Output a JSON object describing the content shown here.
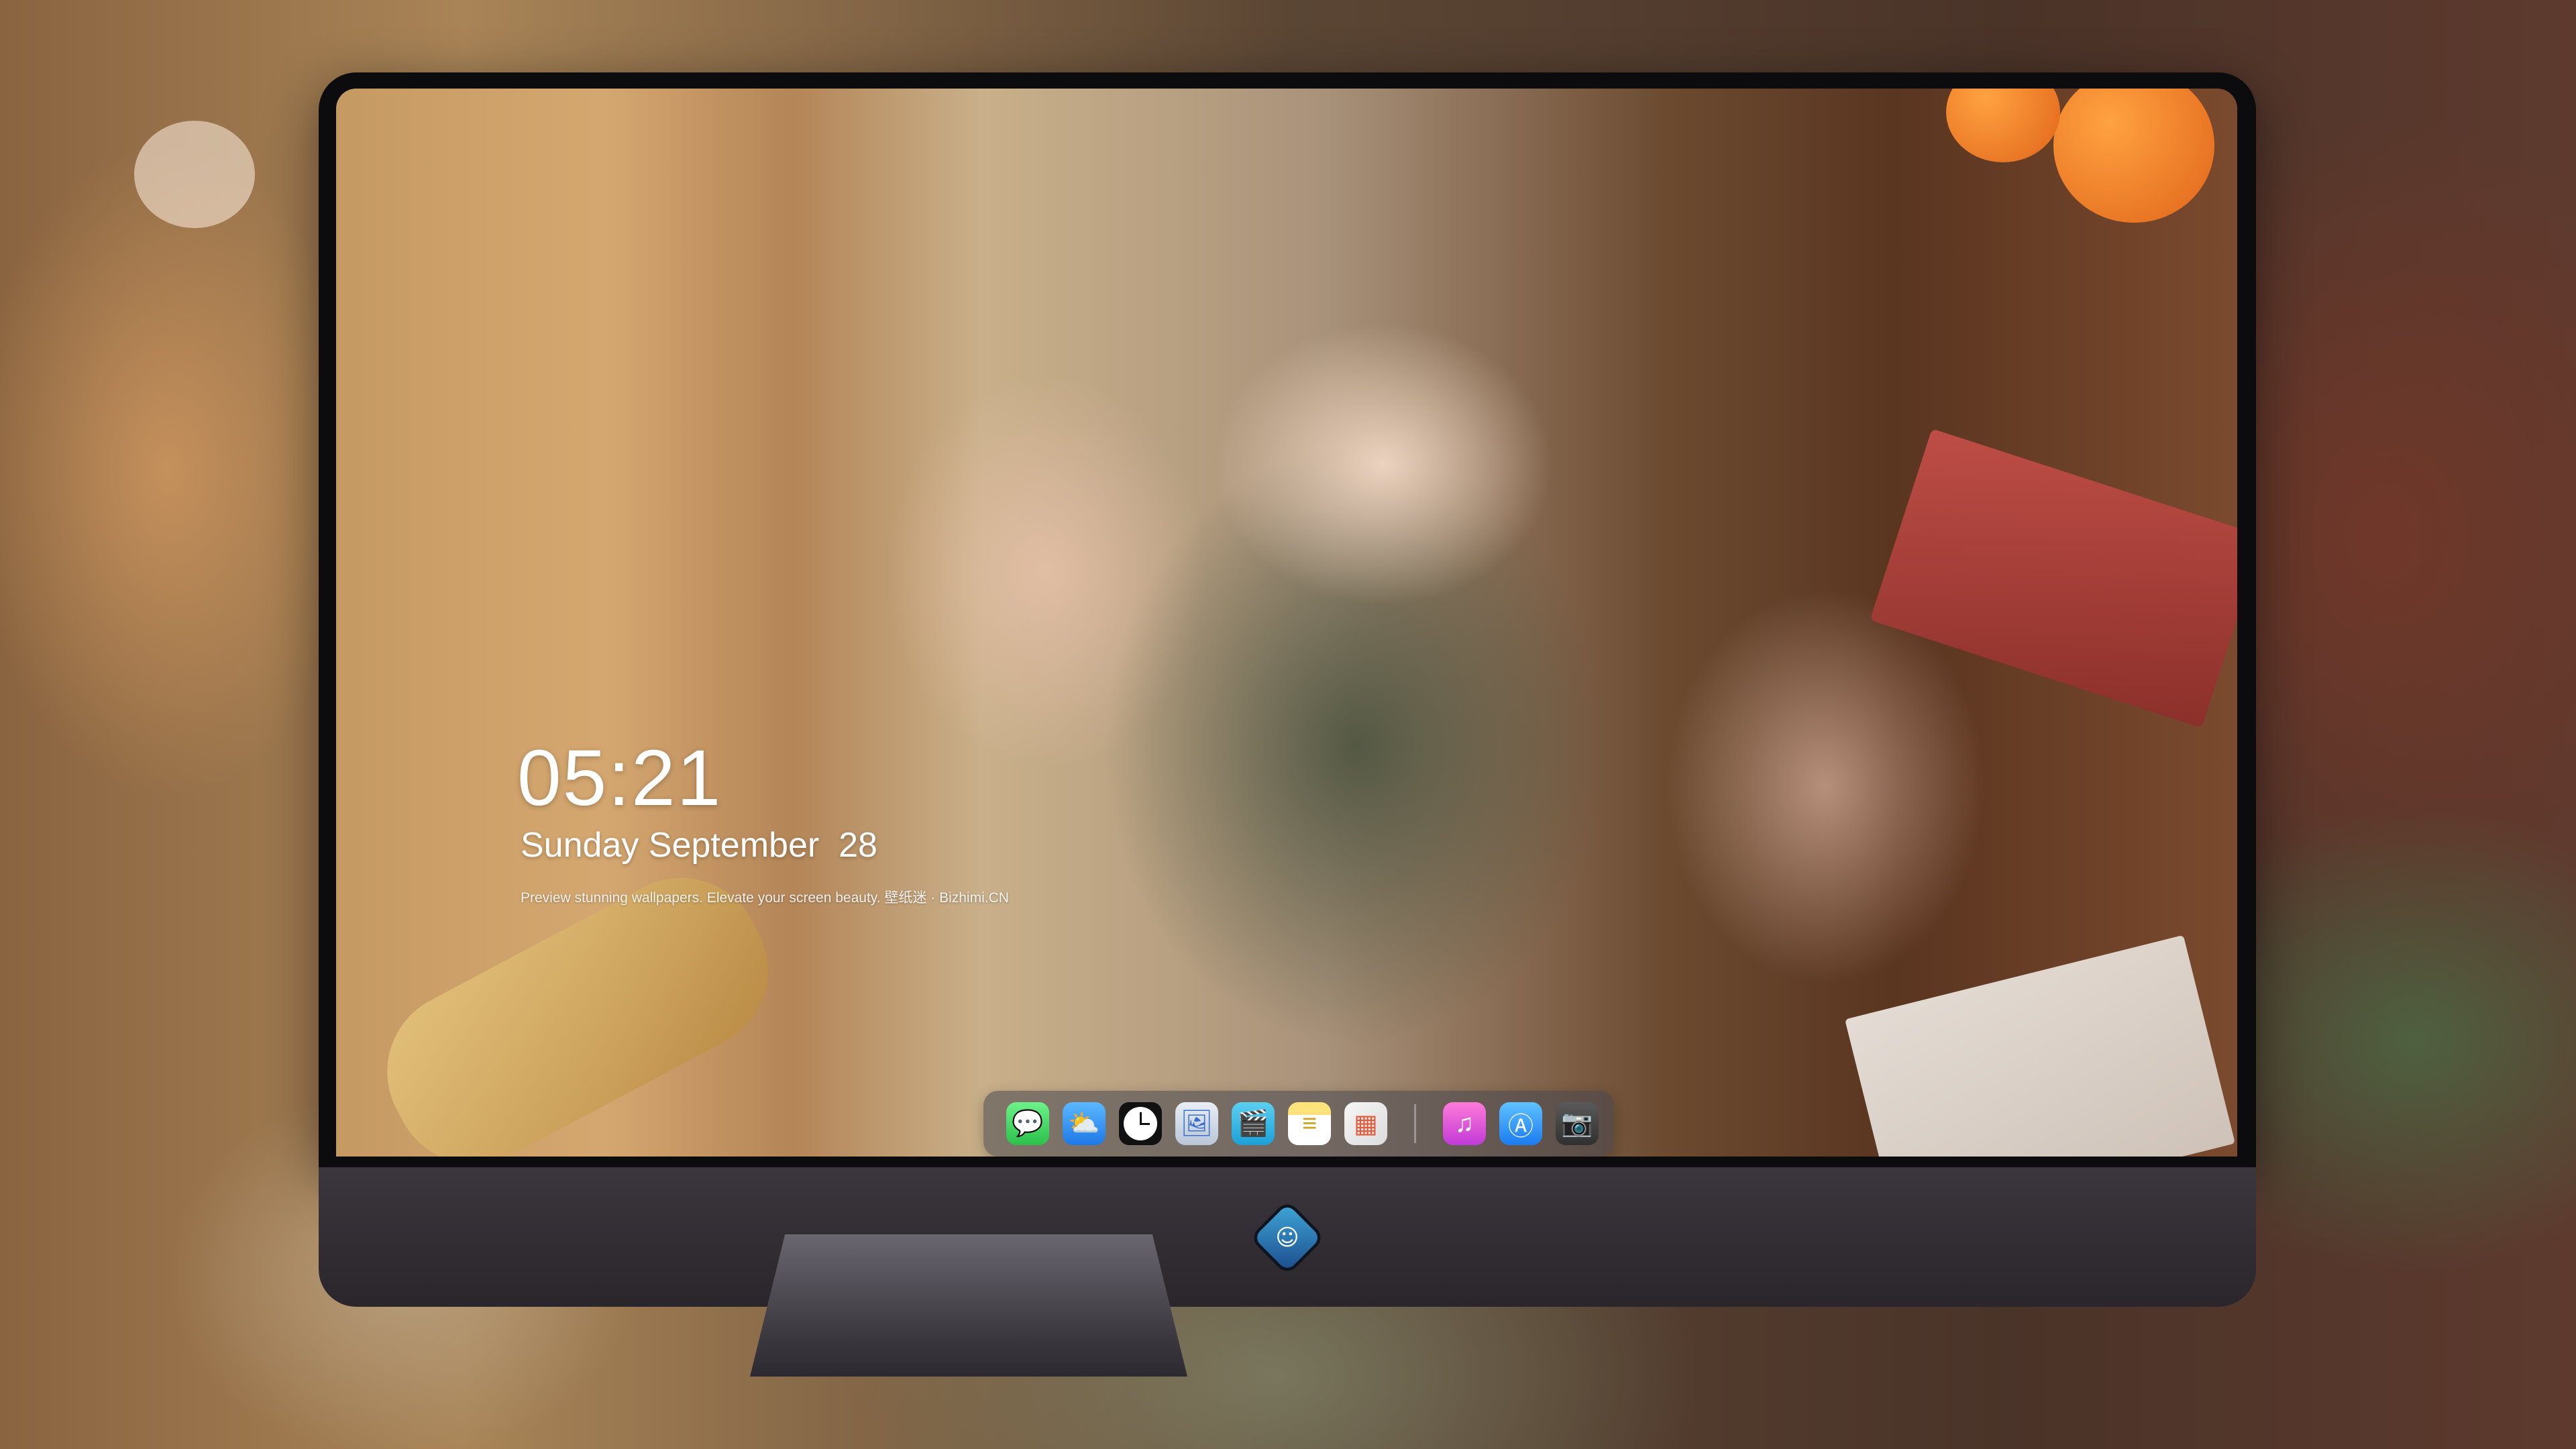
{
  "lock_screen": {
    "time": "05:21",
    "date": "Sunday September  28",
    "tagline": "Preview stunning wallpapers. Elevate your screen beauty. 壁纸迷 · Bizhimi.CN"
  },
  "dock": {
    "apps": [
      {
        "name": "Messages",
        "glyph": "💬"
      },
      {
        "name": "Weather",
        "glyph": "⛅"
      },
      {
        "name": "Clock",
        "glyph": ""
      },
      {
        "name": "Preview",
        "glyph": "🖼"
      },
      {
        "name": "Clips",
        "glyph": "🎬"
      },
      {
        "name": "Notes",
        "glyph": "≡"
      },
      {
        "name": "Photos",
        "glyph": "▦"
      }
    ],
    "apps_right": [
      {
        "name": "Music",
        "glyph": "♫"
      },
      {
        "name": "App Store",
        "glyph": "Ⓐ"
      },
      {
        "name": "Camera",
        "glyph": "📷"
      }
    ]
  },
  "logo": {
    "glyph": "☺"
  },
  "colors": {
    "bezel": "#0c0c0e",
    "chin": "#322e33",
    "dock": "#46464e"
  }
}
